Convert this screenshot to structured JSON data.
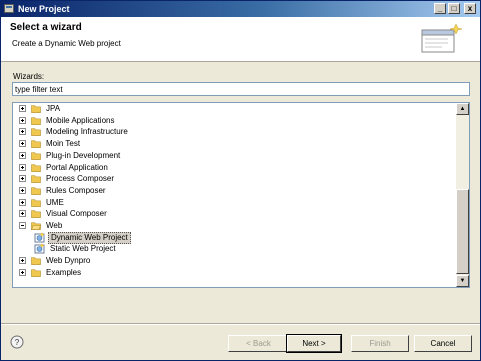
{
  "window": {
    "title": "New Project",
    "minimize": "_",
    "maximize": "□",
    "close": "x"
  },
  "header": {
    "title": "Select a wizard",
    "subtitle": "Create a Dynamic Web project"
  },
  "wizards_label": "Wizards:",
  "filter": {
    "value": "type filter text"
  },
  "tree": [
    {
      "label": "JPA",
      "level": 0,
      "expander": "plus",
      "icon": "folder"
    },
    {
      "label": "Mobile Applications",
      "level": 0,
      "expander": "plus",
      "icon": "folder"
    },
    {
      "label": "Modeling Infrastructure",
      "level": 0,
      "expander": "plus",
      "icon": "folder"
    },
    {
      "label": "Moin Test",
      "level": 0,
      "expander": "plus",
      "icon": "folder"
    },
    {
      "label": "Plug-in Development",
      "level": 0,
      "expander": "plus",
      "icon": "folder"
    },
    {
      "label": "Portal Application",
      "level": 0,
      "expander": "plus",
      "icon": "folder"
    },
    {
      "label": "Process Composer",
      "level": 0,
      "expander": "plus",
      "icon": "folder"
    },
    {
      "label": "Rules Composer",
      "level": 0,
      "expander": "plus",
      "icon": "folder"
    },
    {
      "label": "UME",
      "level": 0,
      "expander": "plus",
      "icon": "folder"
    },
    {
      "label": "Visual Composer",
      "level": 0,
      "expander": "plus",
      "icon": "folder"
    },
    {
      "label": "Web",
      "level": 0,
      "expander": "minus",
      "icon": "folder-open"
    },
    {
      "label": "Dynamic Web Project",
      "level": 1,
      "expander": "none",
      "icon": "web-project",
      "selected": true
    },
    {
      "label": "Static Web Project",
      "level": 1,
      "expander": "none",
      "icon": "web-project"
    },
    {
      "label": "Web Dynpro",
      "level": 0,
      "expander": "plus",
      "icon": "folder"
    },
    {
      "label": "Examples",
      "level": 0,
      "expander": "plus",
      "icon": "folder"
    }
  ],
  "buttons": {
    "back": "< Back",
    "next": "Next >",
    "finish": "Finish",
    "cancel": "Cancel"
  },
  "colors": {
    "titlebar": "#0a246a",
    "folder": "#f0c850",
    "selection": "#d4d0c8",
    "dialog": "#ece9d8"
  }
}
